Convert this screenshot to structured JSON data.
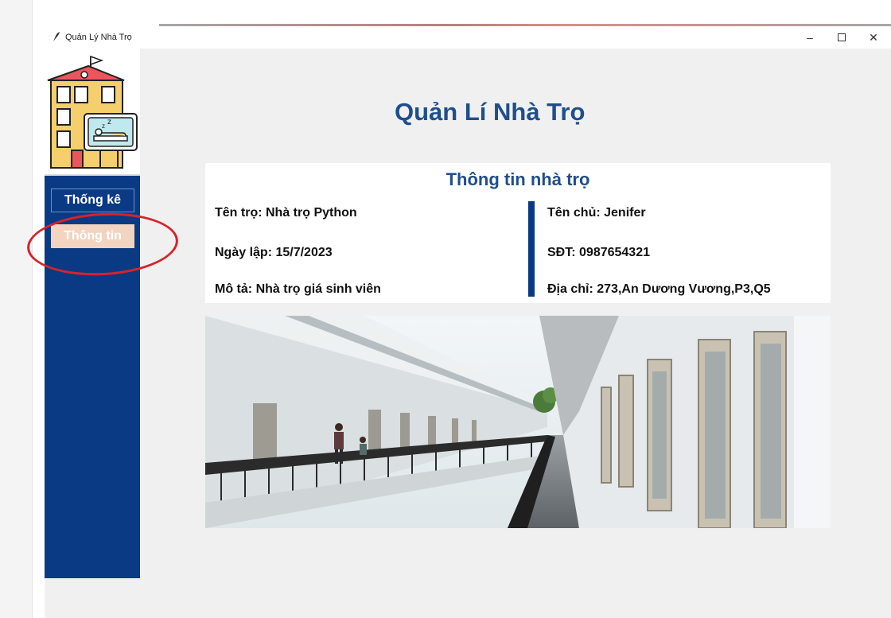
{
  "window": {
    "title": "Quản Lý Nhà Trọ",
    "minimize_icon": "minimize-icon",
    "maximize_icon": "maximize-icon",
    "close_icon": "close-icon"
  },
  "header": {
    "title": "Quản Lí Nhà Trọ"
  },
  "sidebar": {
    "logo_icon": "boarding-house-logo",
    "buttons": [
      {
        "label": "Thống kê"
      },
      {
        "label": "Thông tin"
      }
    ]
  },
  "info_card": {
    "title": "Thông tin nhà trọ",
    "left": [
      {
        "label": "Tên trọ:",
        "value": "Nhà trọ Python"
      },
      {
        "label": "Ngày lập:",
        "value": "15/7/2023"
      },
      {
        "label": "Mô tả:",
        "value": "Nhà trọ giá sinh viên"
      }
    ],
    "right": [
      {
        "label": "Tên chủ:",
        "value": "Jenifer"
      },
      {
        "label": "SĐT:",
        "value": "0987654321"
      },
      {
        "label": "Địa chỉ:",
        "value": "273,An Dương Vương,P3,Q5"
      }
    ]
  },
  "colors": {
    "accent": "#1f4e8c",
    "sidebar": "#0b3a84",
    "highlight": "#d8232a"
  }
}
